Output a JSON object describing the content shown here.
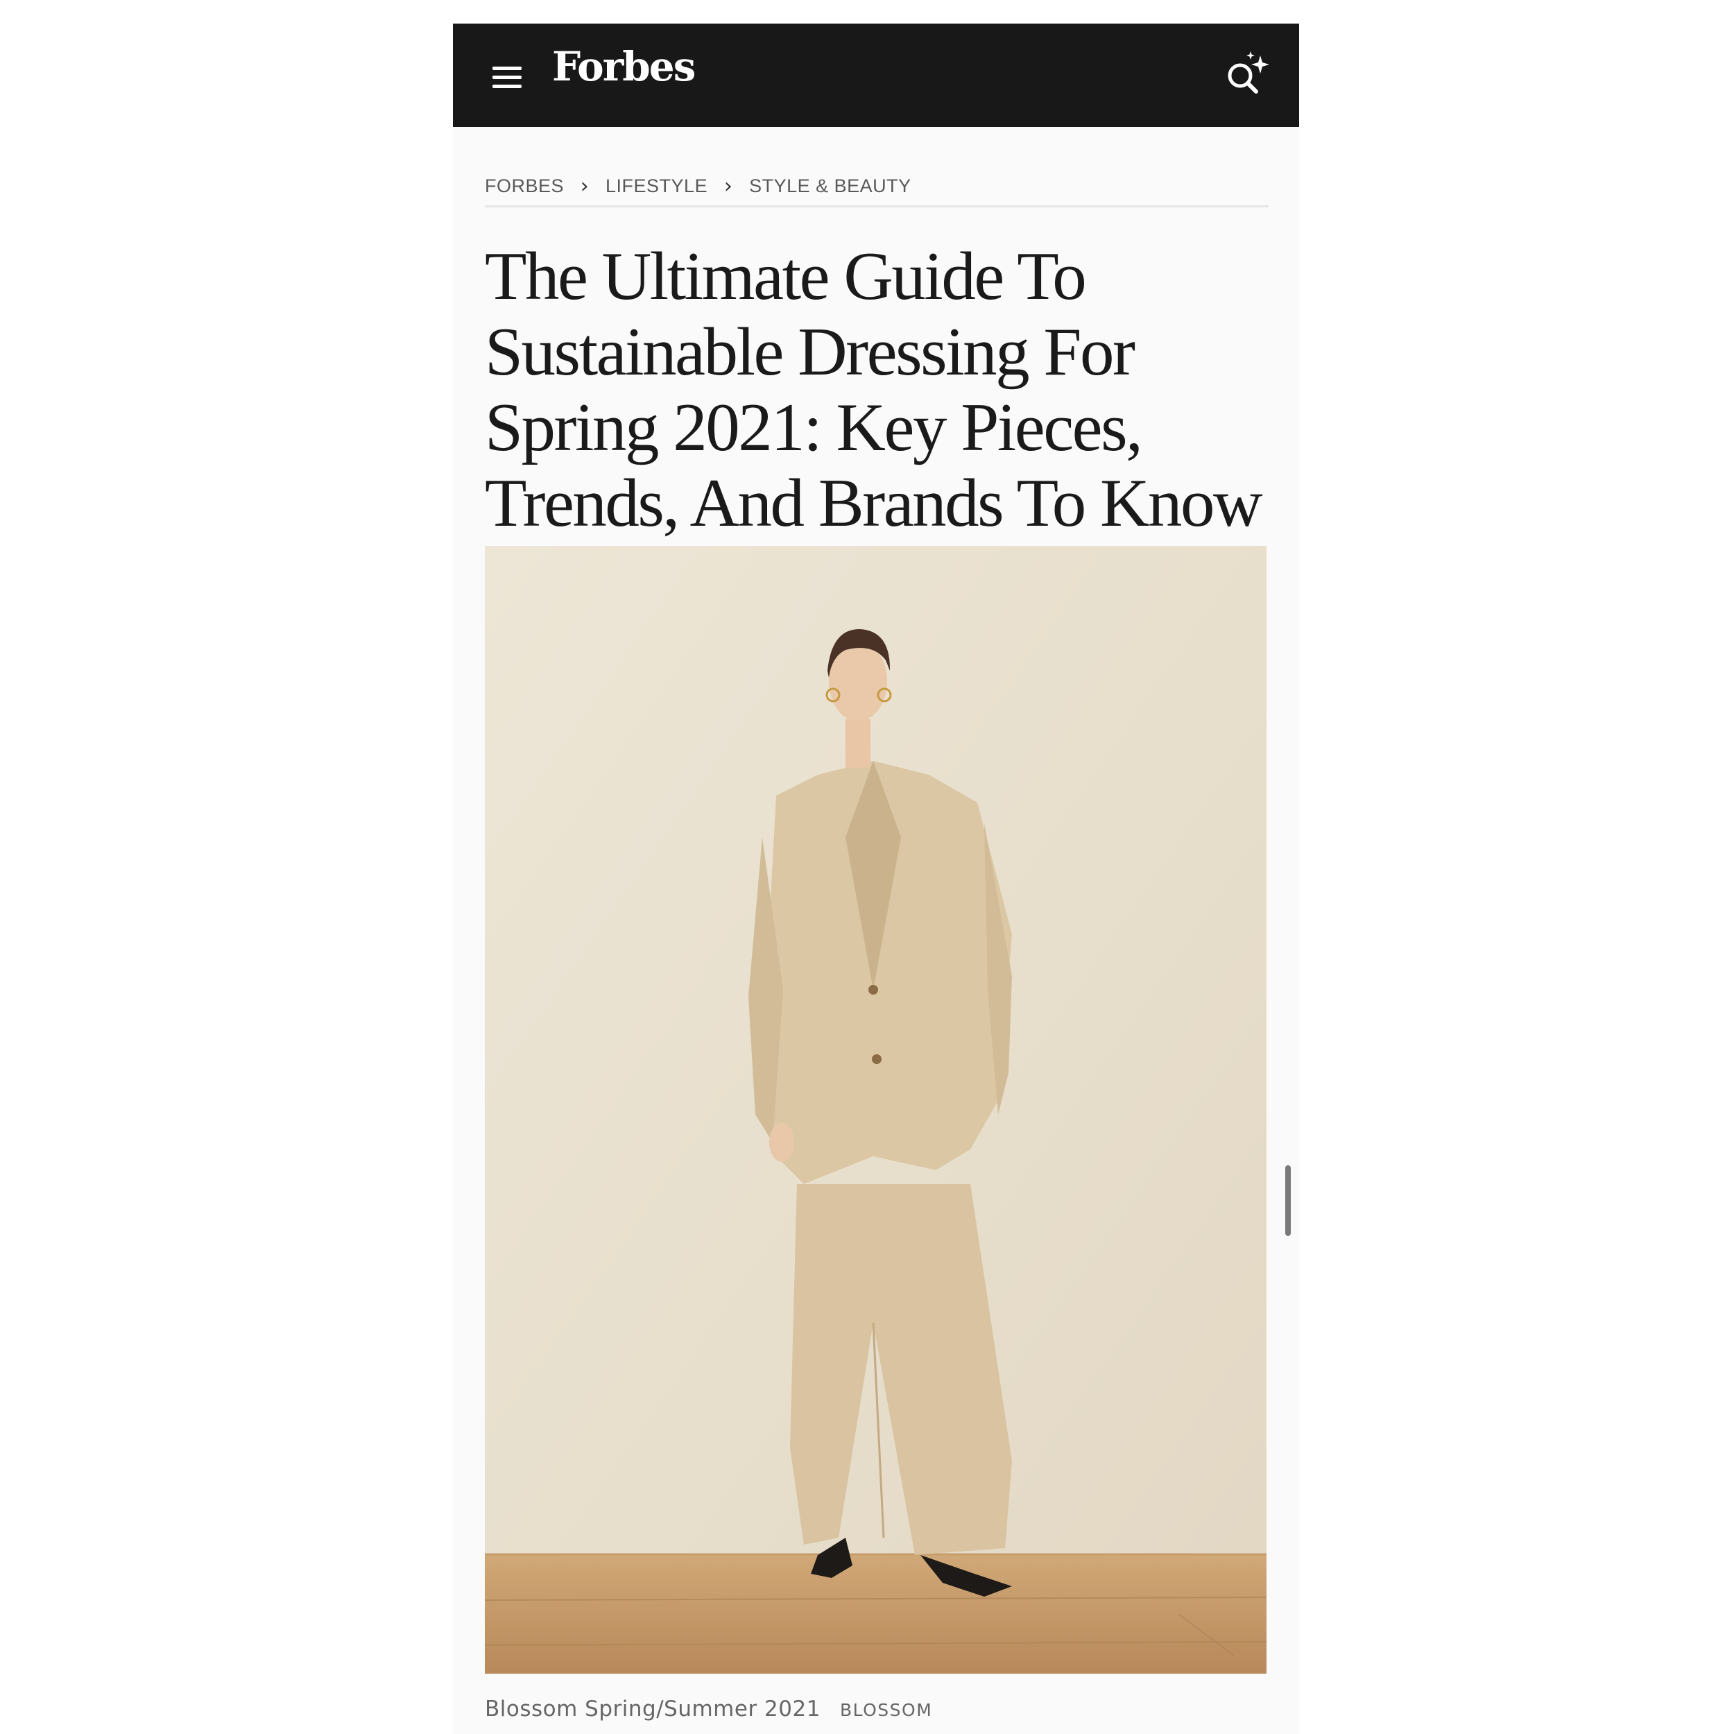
{
  "header": {
    "logo": "Forbes"
  },
  "breadcrumb": {
    "items": [
      "FORBES",
      "LIFESTYLE",
      "STYLE & BEAUTY"
    ],
    "separator": "›"
  },
  "article": {
    "headline": "The Ultimate Guide To Sustainable Dressing For Spring 2021: Key Pieces, Trends, And Brands To Know"
  },
  "image": {
    "caption": "Blossom Spring/Summer 2021",
    "credit": "BLOSSOM"
  },
  "colors": {
    "header_bg": "#181818",
    "page_bg": "#fafafa",
    "text_dark": "#1a1a1a",
    "text_muted": "#666666"
  },
  "icons": [
    "menu-icon",
    "forbes-logo",
    "ai-search-icon",
    "chevron-right-icon"
  ]
}
